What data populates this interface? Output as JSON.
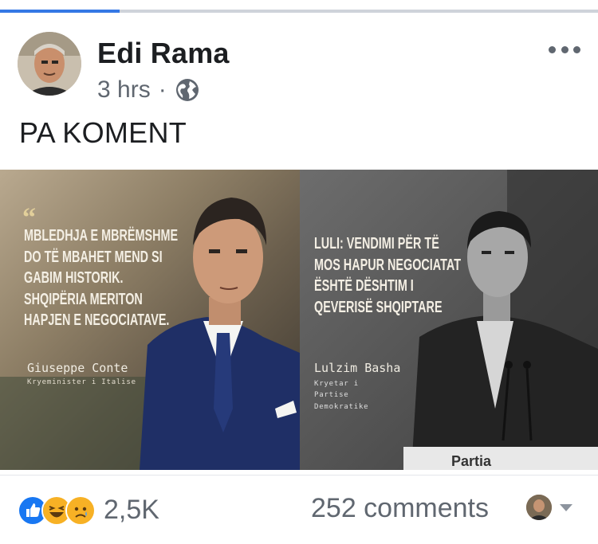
{
  "post": {
    "author": "Edi Rama",
    "time": "3 hrs",
    "separator": "·",
    "privacy_icon": "globe-icon",
    "text": "PA KOMENT",
    "more_icon": "more-horizontal-icon"
  },
  "image": {
    "left_quote": [
      "MBLEDHJA E MBRËMSHME",
      "DO TË MBAHET MEND SI",
      "GABIM HISTORIK.",
      "SHQIPËRIA MERITON",
      "HAPJEN  E NEGOCIATAVE."
    ],
    "left_name": "Giuseppe Conte",
    "left_role": "Kryeminister i Italise",
    "right_quote": [
      "LULI: VENDIMI PËR TË",
      "MOS HAPUR NEGOCIATAT",
      "ËSHTË DËSHTIM I",
      "QEVERISË SHQIPTARE"
    ],
    "right_name": "Lulzim Basha",
    "right_role": "Kryetar i Partise Demokratike",
    "podium_text": "Partia"
  },
  "footer": {
    "reaction_icons": [
      "like-icon",
      "haha-icon",
      "sad-icon"
    ],
    "reaction_count": "2,5K",
    "comments": "252 comments"
  },
  "colors": {
    "accent": "#3578e5",
    "secondary_text": "#606770",
    "like": "#1877f2",
    "emoji": "#f7b125"
  },
  "progress": {
    "value": 0.2
  }
}
